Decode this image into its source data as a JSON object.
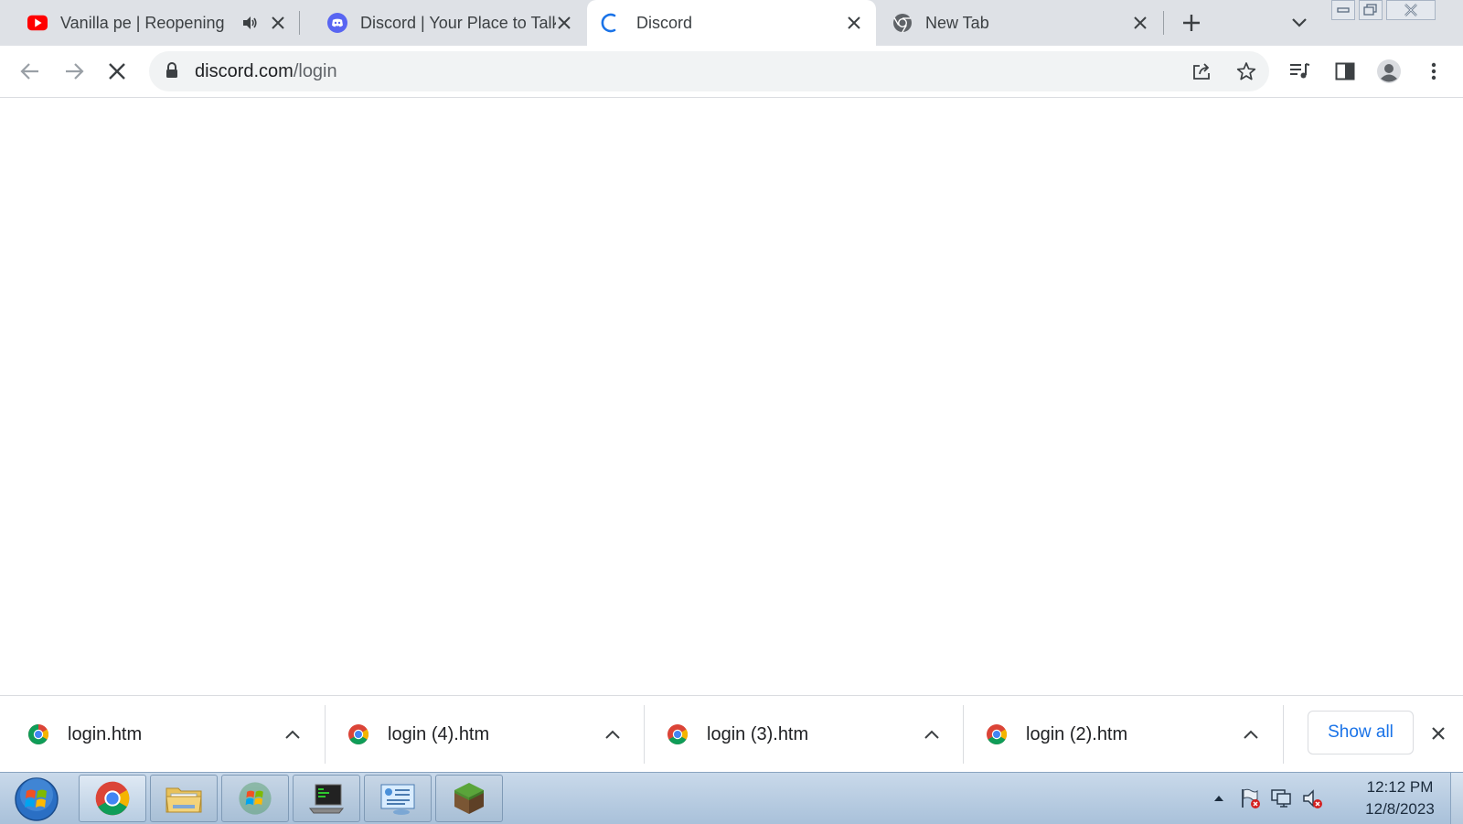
{
  "tabs": [
    {
      "title": "Vanilla pe | Reopening",
      "icon": "youtube-icon",
      "audio": true
    },
    {
      "title": "Discord | Your Place to Talk",
      "icon": "discord-icon"
    },
    {
      "title": "Discord",
      "icon": "loading-spinner-icon",
      "active": true
    },
    {
      "title": "New Tab",
      "icon": "chrome-icon"
    }
  ],
  "toolbar": {
    "url_host": "discord.com",
    "url_path": "/login"
  },
  "downloads": {
    "items": [
      {
        "name": "login.htm"
      },
      {
        "name": "login (4).htm"
      },
      {
        "name": "login (3).htm"
      },
      {
        "name": "login (2).htm"
      }
    ],
    "show_all_label": "Show all"
  },
  "taskbar": {
    "apps": [
      "chrome-icon",
      "file-explorer-icon",
      "windows-logo-icon",
      "terminal-icon",
      "control-panel-icon",
      "minecraft-icon"
    ],
    "time": "12:12 PM",
    "date": "12/8/2023"
  },
  "colors": {
    "tabstrip": "#dee1e6",
    "accent_blue": "#1a73e8",
    "youtube_red": "#ff0000",
    "discord_blurple": "#5865f2"
  }
}
